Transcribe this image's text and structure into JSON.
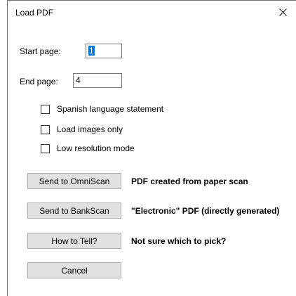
{
  "window": {
    "title": "Load PDF",
    "close_glyph": "✕"
  },
  "fields": {
    "start_page_label": "Start page:",
    "start_page_value": "1",
    "end_page_label": "End page:",
    "end_page_value": "4"
  },
  "options": [
    {
      "label": "Spanish language statement",
      "checked": false
    },
    {
      "label": "Load images only",
      "checked": false
    },
    {
      "label": "Low resolution mode",
      "checked": false
    }
  ],
  "actions": [
    {
      "button": "Send to OmniScan",
      "description": "PDF created from paper scan"
    },
    {
      "button": "Send to BankScan",
      "description": "\"Electronic\" PDF (directly generated)"
    },
    {
      "button": "How to Tell?",
      "description": "Not sure which to pick?"
    }
  ],
  "cancel_label": "Cancel",
  "colors": {
    "selection": "#0078d7",
    "button_face": "#e1e1e1",
    "button_border": "#adadad"
  }
}
